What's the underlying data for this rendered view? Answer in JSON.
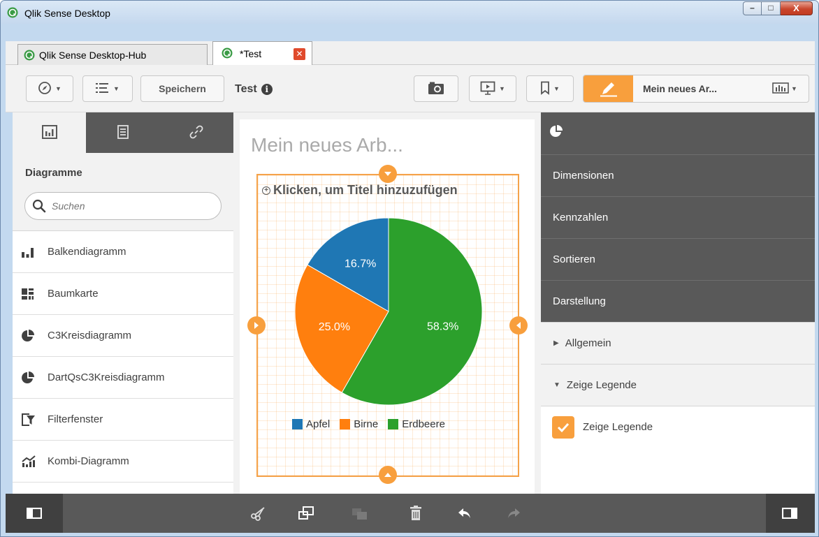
{
  "window": {
    "title": "Qlik Sense Desktop",
    "controls": {
      "minimize": "–",
      "maximize": "□",
      "close": "X"
    }
  },
  "tabs": [
    {
      "label": "Qlik Sense Desktop-Hub"
    },
    {
      "label": "*Test",
      "close": "✕"
    }
  ],
  "toolbar": {
    "save_label": "Speichern",
    "app_title": "Test",
    "info": "i",
    "sheet_name": "Mein neues Ar..."
  },
  "left_panel": {
    "heading": "Diagramme",
    "search_placeholder": "Suchen",
    "items": [
      {
        "label": "Balkendiagramm",
        "icon": "bar-chart-icon"
      },
      {
        "label": "Baumkarte",
        "icon": "treemap-icon"
      },
      {
        "label": "C3Kreisdiagramm",
        "icon": "pie-chart-icon"
      },
      {
        "label": "DartQsC3Kreisdiagramm",
        "icon": "pie-chart-icon"
      },
      {
        "label": "Filterfenster",
        "icon": "filter-pane-icon"
      },
      {
        "label": "Kombi-Diagramm",
        "icon": "combo-chart-icon"
      }
    ]
  },
  "sheet": {
    "title": "Mein neues Arb...",
    "viz_title_prompt": "Klicken, um Titel hinzuzufügen"
  },
  "chart_data": {
    "type": "pie",
    "categories": [
      "Apfel",
      "Birne",
      "Erdbeere"
    ],
    "values": [
      16.7,
      25.0,
      58.3
    ],
    "labels": [
      "16.7%",
      "25.0%",
      "58.3%"
    ],
    "colors": [
      "#1f77b4",
      "#ff7f0e",
      "#2ca02c"
    ],
    "legend_position": "bottom"
  },
  "right_panel": {
    "sections": [
      "Dimensionen",
      "Kennzahlen",
      "Sortieren",
      "Darstellung"
    ],
    "subsections": [
      {
        "label": "Allgemein",
        "arrow": "▶"
      },
      {
        "label": "Zeige Legende",
        "arrow": "▼"
      }
    ],
    "checkbox_label": "Zeige Legende",
    "checkbox_checked": true
  },
  "colors": {
    "accent": "#f89f3d",
    "dark_panel": "#595959",
    "light_panel": "#f2f2f2"
  }
}
